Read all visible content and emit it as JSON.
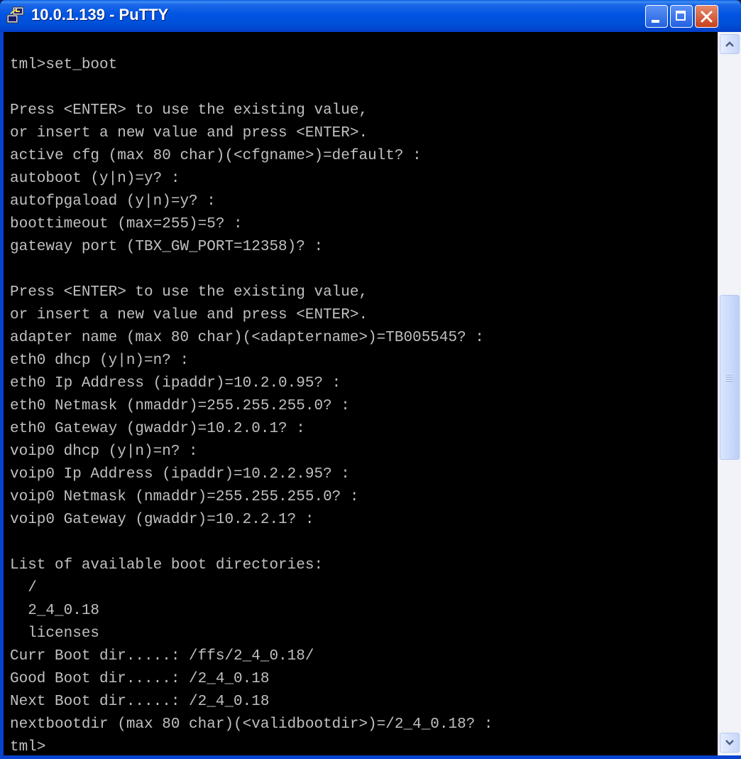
{
  "window": {
    "title": "10.0.1.139 - PuTTY",
    "app_icon": "putty-icon",
    "controls": {
      "minimize_icon": "minimize-icon",
      "maximize_icon": "maximize-icon",
      "close_icon": "close-icon"
    }
  },
  "terminal": {
    "foreground": "#c0c0c0",
    "background": "#000000",
    "lines": [
      "tml>set_boot",
      "",
      "Press <ENTER> to use the existing value,",
      "or insert a new value and press <ENTER>.",
      "active cfg (max 80 char)(<cfgname>)=default? :",
      "autoboot (y|n)=y? :",
      "autofpgaload (y|n)=y? :",
      "boottimeout (max=255)=5? :",
      "gateway port (TBX_GW_PORT=12358)? :",
      "",
      "Press <ENTER> to use the existing value,",
      "or insert a new value and press <ENTER>.",
      "adapter name (max 80 char)(<adaptername>)=TB005545? :",
      "eth0 dhcp (y|n)=n? :",
      "eth0 Ip Address (ipaddr)=10.2.0.95? :",
      "eth0 Netmask (nmaddr)=255.255.255.0? :",
      "eth0 Gateway (gwaddr)=10.2.0.1? :",
      "voip0 dhcp (y|n)=n? :",
      "voip0 Ip Address (ipaddr)=10.2.2.95? :",
      "voip0 Netmask (nmaddr)=255.255.255.0? :",
      "voip0 Gateway (gwaddr)=10.2.2.1? :",
      "",
      "List of available boot directories:",
      "  /",
      "  2_4_0.18",
      "  licenses",
      "Curr Boot dir.....: /ffs/2_4_0.18/",
      "Good Boot dir.....: /2_4_0.18",
      "Next Boot dir.....: /2_4_0.18",
      "nextbootdir (max 80 char)(<validbootdir>)=/2_4_0.18? :",
      "tml>"
    ]
  },
  "scrollbar": {
    "up_icon": "scroll-up-arrow-icon",
    "down_icon": "scroll-down-arrow-icon",
    "position": 0.52
  }
}
